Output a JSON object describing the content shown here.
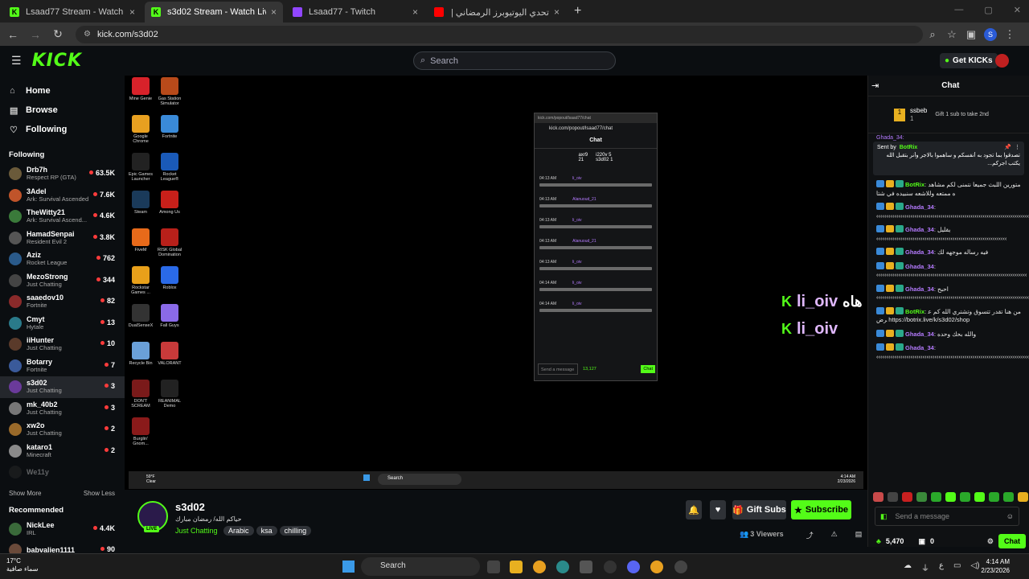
{
  "browser": {
    "tabs": [
      {
        "title": "Lsaad77 Stream - Watch Live on Kick",
        "icon": "kick"
      },
      {
        "title": "s3d02 Stream - Watch Live on Kick",
        "icon": "kick",
        "active": true
      },
      {
        "title": "Lsaad77 - Twitch",
        "icon": "twitch"
      },
      {
        "title": "تحدي اليوتيوبرز الرمضاني | سوبر",
        "icon": "youtube"
      }
    ],
    "url": "kick.com/s3d02",
    "profile": "S"
  },
  "header": {
    "logo": "KICK",
    "search_placeholder": "Search",
    "get_kicks": "Get KICKs"
  },
  "sidebar": {
    "nav": [
      {
        "label": "Home",
        "icon": "home-icon"
      },
      {
        "label": "Browse",
        "icon": "compass-icon"
      },
      {
        "label": "Following",
        "icon": "heart-icon"
      }
    ],
    "following_title": "Following",
    "channels": [
      {
        "name": "Drb7h",
        "game": "Respect RP (GTA)",
        "viewers": "63.5K",
        "color": "#6a5a3a"
      },
      {
        "name": "3Adel",
        "game": "Ark: Survival Ascended",
        "viewers": "7.6K",
        "color": "#c0542a"
      },
      {
        "name": "TheWitty21",
        "game": "Ark: Survival Ascend...",
        "viewers": "4.6K",
        "color": "#3a7a3a"
      },
      {
        "name": "HamadSenpai",
        "game": "Resident Evil 2",
        "viewers": "3.8K",
        "color": "#555"
      },
      {
        "name": "Aziz",
        "game": "Rocket League",
        "viewers": "762",
        "color": "#2a5a8a"
      },
      {
        "name": "MezoStrong",
        "game": "Just Chatting",
        "viewers": "344",
        "color": "#444"
      },
      {
        "name": "saaedov10",
        "game": "Fortnite",
        "viewers": "82",
        "color": "#8a2a2a"
      },
      {
        "name": "Cmyt",
        "game": "Hytale",
        "viewers": "13",
        "color": "#2a7a8a"
      },
      {
        "name": "iiHunter",
        "game": "Just Chatting",
        "viewers": "10",
        "color": "#5a3a2a"
      },
      {
        "name": "Botarry",
        "game": "Fortnite",
        "viewers": "7",
        "color": "#3a5a9a"
      },
      {
        "name": "s3d02",
        "game": "Just Chatting",
        "viewers": "3",
        "color": "#6a3a9a",
        "active": true
      },
      {
        "name": "mk_40b2",
        "game": "Just Chatting",
        "viewers": "3",
        "color": "#777"
      },
      {
        "name": "xw2o",
        "game": "Just Chatting",
        "viewers": "2",
        "color": "#9a6a2a"
      },
      {
        "name": "kataro1",
        "game": "Minecraft",
        "viewers": "2",
        "color": "#8a8a8a"
      },
      {
        "name": "We11y",
        "game": "",
        "viewers": "",
        "color": "#333"
      }
    ],
    "show_more": "Show More",
    "show_less": "Show Less",
    "recommended_title": "Recommended",
    "recommended": [
      {
        "name": "NickLee",
        "game": "IRL",
        "viewers": "4.4K",
        "color": "#3a6a3a"
      },
      {
        "name": "babvalien1111",
        "game": "",
        "viewers": "90",
        "color": "#6a4a3a"
      }
    ]
  },
  "desktop_icons": [
    {
      "label": "Mine Genie",
      "color": "#d8222a"
    },
    {
      "label": "Gas Station Simulator",
      "color": "#b84a1a"
    },
    {
      "label": "Google Chrome",
      "color": "#e8a020"
    },
    {
      "label": "Fortnite",
      "color": "#3a8ad8"
    },
    {
      "label": "Epic Games Launcher",
      "color": "#222"
    },
    {
      "label": "Rocket League®",
      "color": "#1a5ab8"
    },
    {
      "label": "Steam",
      "color": "#1a3a5a"
    },
    {
      "label": "Among Us",
      "color": "#c8201a"
    },
    {
      "label": "FiveM",
      "color": "#e86a1a"
    },
    {
      "label": "RISK Global Domination",
      "color": "#b8201a"
    },
    {
      "label": "Rockstar Games ...",
      "color": "#e8a01a"
    },
    {
      "label": "Roblox",
      "color": "#2a6ae8"
    },
    {
      "label": "DualSenseX",
      "color": "#333"
    },
    {
      "label": "Fall Guys",
      "color": "#8a6ae8"
    },
    {
      "label": "Recycle Bin",
      "color": "#6aa0d8"
    },
    {
      "label": "VALORANT",
      "color": "#c83a3a"
    },
    {
      "label": "DON'T SCREAM",
      "color": "#7a1a1a"
    },
    {
      "label": "REANIMAL Demo",
      "color": "#222"
    },
    {
      "label": "Burglin' Gnom...",
      "color": "#8a1a1a"
    }
  ],
  "popup": {
    "url": "kick.com/popout/lsaad77/chat",
    "title": "Chat",
    "top_users": [
      {
        "name": "axr9",
        "count": "21"
      },
      {
        "name": "i220v",
        "count": "5"
      },
      {
        "name": "s3d02",
        "count": "1"
      }
    ],
    "times": [
      "04:13 AM",
      "04:13 AM",
      "04:13 AM",
      "04:13 AM",
      "04:13 AM",
      "04:14 AM",
      "04:14 AM"
    ],
    "users": [
      "li_oiv",
      "Alanuoud_21",
      "li_oiv",
      "Alanuoud_21",
      "li_oiv",
      "li_oiv",
      "li_oiv"
    ],
    "send_placeholder": "Send a message",
    "kicks": "13,127",
    "chat_btn": "Chat"
  },
  "overlay": {
    "line1": "li_oiv",
    "line1_ar": "هاه",
    "line2": "li_oiv"
  },
  "vtaskbar": {
    "weather": "59°F",
    "weather_desc": "Clear",
    "search": "Search",
    "time": "4:14 AM",
    "date": "2/23/2026"
  },
  "stream": {
    "name": "s3d02",
    "title": "حياكم الله/ رمضان مبارك",
    "category": "Just Chatting",
    "tags": [
      "Arabic",
      "ksa",
      "chilling"
    ],
    "live": "LIVE",
    "viewers": "3 Viewers",
    "gift_subs": "Gift Subs",
    "subscribe": "Subscribe"
  },
  "chat": {
    "title": "Chat",
    "top_gifter": {
      "name": "ssbeb",
      "count": "1",
      "cta": "Gift 1 sub to take 2nd"
    },
    "pinned": {
      "by": "Sent by",
      "bot": "BotRix",
      "text": "تصدقوا بما تجود به أنفسكم و ساهموا بالاجر وأنر بتقبل الله يكتب اجركم..."
    },
    "partial_top": "Ghada_34:",
    "messages": [
      {
        "user": "BotRix",
        "color": "#53fc18",
        "text": "متورين اللبث جميعا نتمنى لكم مشاهده ممتعه وللاشعه سنبيده في شتا",
        "bot": true
      },
      {
        "user": "Ghada_34",
        "color": "#b57bff",
        "text": "‹‹‹‹‹‹‹‹‹‹‹‹‹‹‹‹‹‹‹‹‹‹‹‹‹‹‹‹‹‹‹‹‹‹‹‹‹‹‹‹‹‹‹‹‹‹‹‹‹‹‹‹‹‹‹‹‹‹‹‹‹‹‹‹‹‹‹‹‹‹‹‹‹‹‹‹‹‹‹‹‹‹‹‹‹‹‹‹‹‹‹‹‹‹‹‹‹‹‹‹‹‹‹‹‹‹‹‹‹‹"
      },
      {
        "user": "Ghada_34",
        "color": "#b57bff",
        "text": "يقليل ‹‹‹‹‹‹‹‹‹‹‹‹‹‹‹‹‹‹‹‹‹‹‹‹‹‹‹‹‹‹‹‹‹‹‹‹‹‹‹‹‹‹‹‹‹‹‹‹‹‹‹‹‹‹‹‹‹‹‹‹‹‹‹‹‹"
      },
      {
        "user": "Ghada_34",
        "color": "#b57bff",
        "text": "فيه رساله موجهه لك"
      },
      {
        "user": "Ghada_34",
        "color": "#b57bff",
        "text": "‹‹‹‹‹‹‹‹‹‹‹‹‹‹‹‹‹‹‹‹‹‹‹‹‹‹‹‹‹‹‹‹‹‹‹‹‹‹‹‹‹‹‹‹‹‹‹‹‹‹‹‹‹‹‹‹‹‹‹‹‹‹‹‹‹‹‹‹‹‹‹‹‹‹‹"
      },
      {
        "user": "Ghada_34",
        "color": "#b57bff",
        "text": "احبح ‹‹‹‹‹‹‹‹‹‹‹‹‹‹‹‹‹‹‹‹‹‹‹‹‹‹‹‹‹‹‹‹‹‹‹‹‹‹‹‹‹‹‹‹‹‹‹‹‹‹‹‹‹‹‹‹‹‹‹‹‹‹‹‹‹‹‹‹‹‹‹‹‹‹‹‹‹‹‹‹‹‹‹‹‹‹‹‹‹‹‹"
      },
      {
        "user": "BotRix",
        "color": "#53fc18",
        "text": "من هنا تقدر تتسوق وتشتري الله كم عرض https://botrix.live/k/s3d02/shop",
        "bot": true
      },
      {
        "user": "Ghada_34",
        "color": "#b57bff",
        "text": "والله بحك وحده"
      },
      {
        "user": "Ghada_34",
        "color": "#b57bff",
        "text": "‹‹‹‹‹‹‹‹‹‹‹‹‹‹‹‹‹‹‹‹‹‹‹‹‹‹‹‹‹‹‹‹‹‹‹‹‹‹‹‹‹‹‹‹‹‹‹‹‹‹‹‹‹‹‹‹‹‹‹‹‹‹‹‹‹‹‹‹‹‹‹‹‹‹‹‹‹‹‹‹‹‹‹‹‹‹‹‹‹‹‹‹‹‹‹‹‹"
      }
    ],
    "send_placeholder": "Send a message",
    "kicks": "5,470",
    "gifts": "0",
    "chat_btn": "Chat"
  },
  "os_taskbar": {
    "weather": "17°C",
    "weather_desc": "سماء صافية",
    "search": "Search",
    "time": "4:14 AM",
    "date": "2/23/2026",
    "lang": "ع"
  }
}
